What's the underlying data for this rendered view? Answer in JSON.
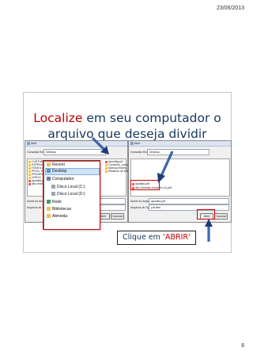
{
  "header": {
    "date": "23/06/2013"
  },
  "slide": {
    "title_highlight": "Localize",
    "title_rest": " em seu computador o",
    "title_line2": "arquivo que deseja dividir",
    "callout_prefix": "Clique em ",
    "callout_action": "‘ABRIR’",
    "accent_color": "#c00000",
    "text_color": "#17375e"
  },
  "dialog_left": {
    "title": "Abrir",
    "lookin_label": "Consultar Em:",
    "lookin_value": "Desktop",
    "files": [
      "CURITIBA",
      "ESPERA",
      "HOMOLOG",
      "PROC. ELE",
      "PROGRA",
      "UDESC",
      "apostila.pdf",
      "abc-remedio"
    ],
    "filename_label": "Nome do Arquivo:",
    "filetype_label": "Arquivos do Tipo:",
    "open_button": "Abrir",
    "cancel_button": "Cancelar",
    "dropdown": [
      "Recent",
      "Desktop",
      "Computador",
      "Disco Local (C:)",
      "Disco Local (D:)",
      "Rede",
      "Bibliotecas",
      "Alimeida"
    ],
    "list_right": [
      "Apostila.pdf",
      "Conselho_contratos",
      "Manual-Ensino_a",
      "Relatorio de Ativo"
    ]
  },
  "dialog_right": {
    "title": "Abrir",
    "lookin_label": "Consultar Em:",
    "lookin_value": "Desktop",
    "files": [
      "apostila.pdf",
      "abc-remedio-completo (1).pdf"
    ],
    "filename_label": "Nome do Arquivo:",
    "filename_value": "apostila.pdf",
    "filetype_label": "Arquivos do Tipo:",
    "filetype_value": "pdf files",
    "open_button": "Abrir",
    "cancel_button": "Cancelar"
  },
  "footer": {
    "page_number": "8"
  }
}
